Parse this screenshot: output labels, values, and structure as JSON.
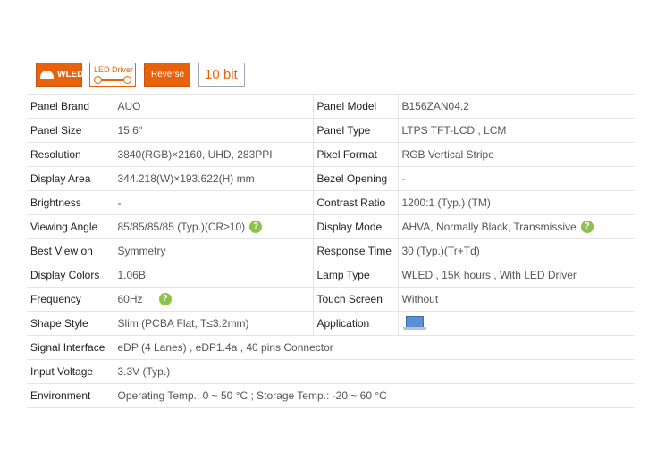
{
  "badges": {
    "wled": "WLED",
    "led_driver": "LED Driver",
    "reverse": "Reverse",
    "bit": "10 bit"
  },
  "specs": {
    "rows": [
      {
        "k1": "Panel Brand",
        "v1": "AUO",
        "k2": "Panel Model",
        "v2": "B156ZAN04.2"
      },
      {
        "k1": "Panel Size",
        "v1": "15.6''",
        "k2": "Panel Type",
        "v2": "LTPS TFT-LCD , LCM"
      },
      {
        "k1": "Resolution",
        "v1": "3840(RGB)×2160, UHD, 283PPI",
        "k2": "Pixel Format",
        "v2": "RGB Vertical Stripe"
      },
      {
        "k1": "Display Area",
        "v1": "344.218(W)×193.622(H) mm",
        "k2": "Bezel Opening",
        "v2": "-"
      },
      {
        "k1": "Brightness",
        "v1": "-",
        "k2": "Contrast Ratio",
        "v2": "1200:1 (Typ.) (TM)"
      },
      {
        "k1": "Viewing Angle",
        "v1": "85/85/85/85 (Typ.)(CR≥10)",
        "k2": "Display Mode",
        "v2": "AHVA, Normally Black, Transmissive"
      },
      {
        "k1": "Best View on",
        "v1": "Symmetry",
        "k2": "Response Time",
        "v2": "30 (Typ.)(Tr+Td)"
      },
      {
        "k1": "Display Colors",
        "v1": "1.06B",
        "k2": "Lamp Type",
        "v2": "WLED , 15K hours , With LED Driver"
      },
      {
        "k1": "Frequency",
        "v1": "60Hz",
        "k2": "Touch Screen",
        "v2": "Without"
      },
      {
        "k1": "Shape Style",
        "v1": "Slim (PCBA Flat, T≤3.2mm)",
        "k2": "Application",
        "v2": ""
      }
    ],
    "wide_rows": [
      {
        "k": "Signal Interface",
        "v": "eDP (4 Lanes) , eDP1.4a , 40 pins Connector"
      },
      {
        "k": "Input Voltage",
        "v": "3.3V (Typ.)"
      },
      {
        "k": "Environment",
        "v": "Operating Temp.: 0 ~ 50 °C ; Storage Temp.: -20 ~ 60 °C"
      }
    ]
  },
  "icons": {
    "help": "?",
    "help_color": "#8bc34a",
    "accent": "#e8620c",
    "application": "laptop-icon"
  }
}
